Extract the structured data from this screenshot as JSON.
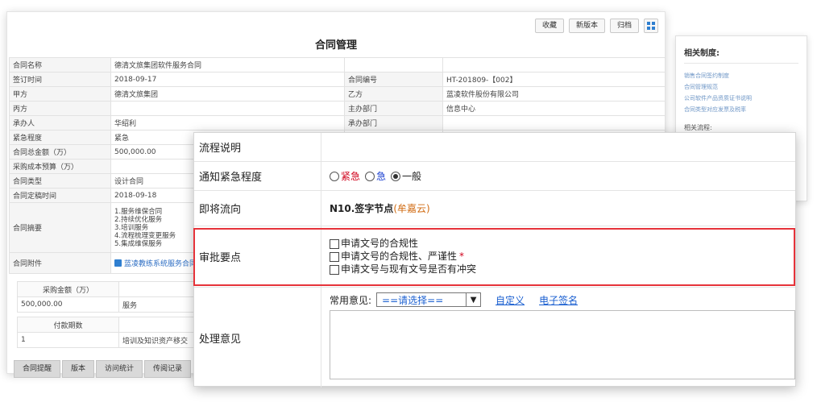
{
  "toolbar": {
    "favorite_label": "收藏",
    "new_version_label": "新版本",
    "archive_label": "归档",
    "grid_icon": "grid-icon"
  },
  "page_title": "合同管理",
  "contract_rows": [
    {
      "label1": "合同名称",
      "value1": "德清文旅集团软件服务合同",
      "label2": "",
      "value2": ""
    },
    {
      "label1": "签订时间",
      "value1": "2018-09-17",
      "label2": "合同编号",
      "value2": "HT-201809-【002】"
    },
    {
      "label1": "甲方",
      "value1": "德清文旅集团",
      "label2": "乙方",
      "value2": "蓝凌软件股份有限公司"
    },
    {
      "label1": "丙方",
      "value1": "",
      "label2": "主办部门",
      "value2": "信息中心"
    },
    {
      "label1": "承办人",
      "value1": "华绍利",
      "label2": "承办部门",
      "value2": ""
    },
    {
      "label1": "紧急程度",
      "value1": "紧急",
      "label2": "",
      "value2": ""
    },
    {
      "label1": "合同总金额（万）",
      "value1": "500,000.00",
      "label2": "",
      "value2": ""
    },
    {
      "label1": "采购成本预算（万）",
      "value1": "",
      "label2": "",
      "value2": ""
    },
    {
      "label1": "合同类型",
      "value1": "设计合同",
      "label2": "",
      "value2": ""
    },
    {
      "label1": "合同定稿时间",
      "value1": "2018-09-18",
      "label2": "",
      "value2": ""
    }
  ],
  "summary": {
    "label": "合同摘要",
    "lines": [
      "1.服务维保合同",
      "2.持续优化服务",
      "3.培训服务",
      "4.流程梳理变更服务",
      "5.集成维保服务"
    ]
  },
  "attachment": {
    "label": "合同附件",
    "file_name": "蓝凌教练系统服务合同"
  },
  "purchase": {
    "header": "采购金额（万）",
    "amount": "500,000.00",
    "item": "服务"
  },
  "payment": {
    "header": "付款期数",
    "index": "1",
    "desc": "培训及知识资产移交"
  },
  "bottom_tabs": [
    "合同提醒",
    "版本",
    "访问统计",
    "传阅记录"
  ],
  "side_panel": {
    "title": "相关制度:",
    "links": [
      "销售合同签约制度",
      "合同管理规范",
      "公司软件产品资质证书说明",
      "合同类型对应发票及税率"
    ],
    "title2": "相关流程:"
  },
  "workflow": {
    "desc_label": "流程说明",
    "desc_value": "",
    "urgency_label": "通知紧急程度",
    "urgency_options": [
      "紧急",
      "急",
      "一般"
    ],
    "urgency_selected": "一般",
    "next_label": "即将流向",
    "next_node": "N10.签字节点",
    "next_person": "(牟嘉云)",
    "points_label": "审批要点",
    "points": [
      "申请文号的合规性",
      "申请文号的合规性、严谨性",
      "申请文号与现有文号是否有冲突"
    ],
    "required_mark": "*",
    "opinion_label": "处理意见",
    "common_opinion_label": "常用意见:",
    "select_value": "==请选择==",
    "custom_link": "自定义",
    "signature_link": "电子签名",
    "opinion_text": ""
  },
  "colors": {
    "highlight": "#e6333a",
    "urgent": "#d0021b",
    "fast": "#1a3fd0",
    "person": "#d06a10",
    "link": "#1a5fd0"
  }
}
